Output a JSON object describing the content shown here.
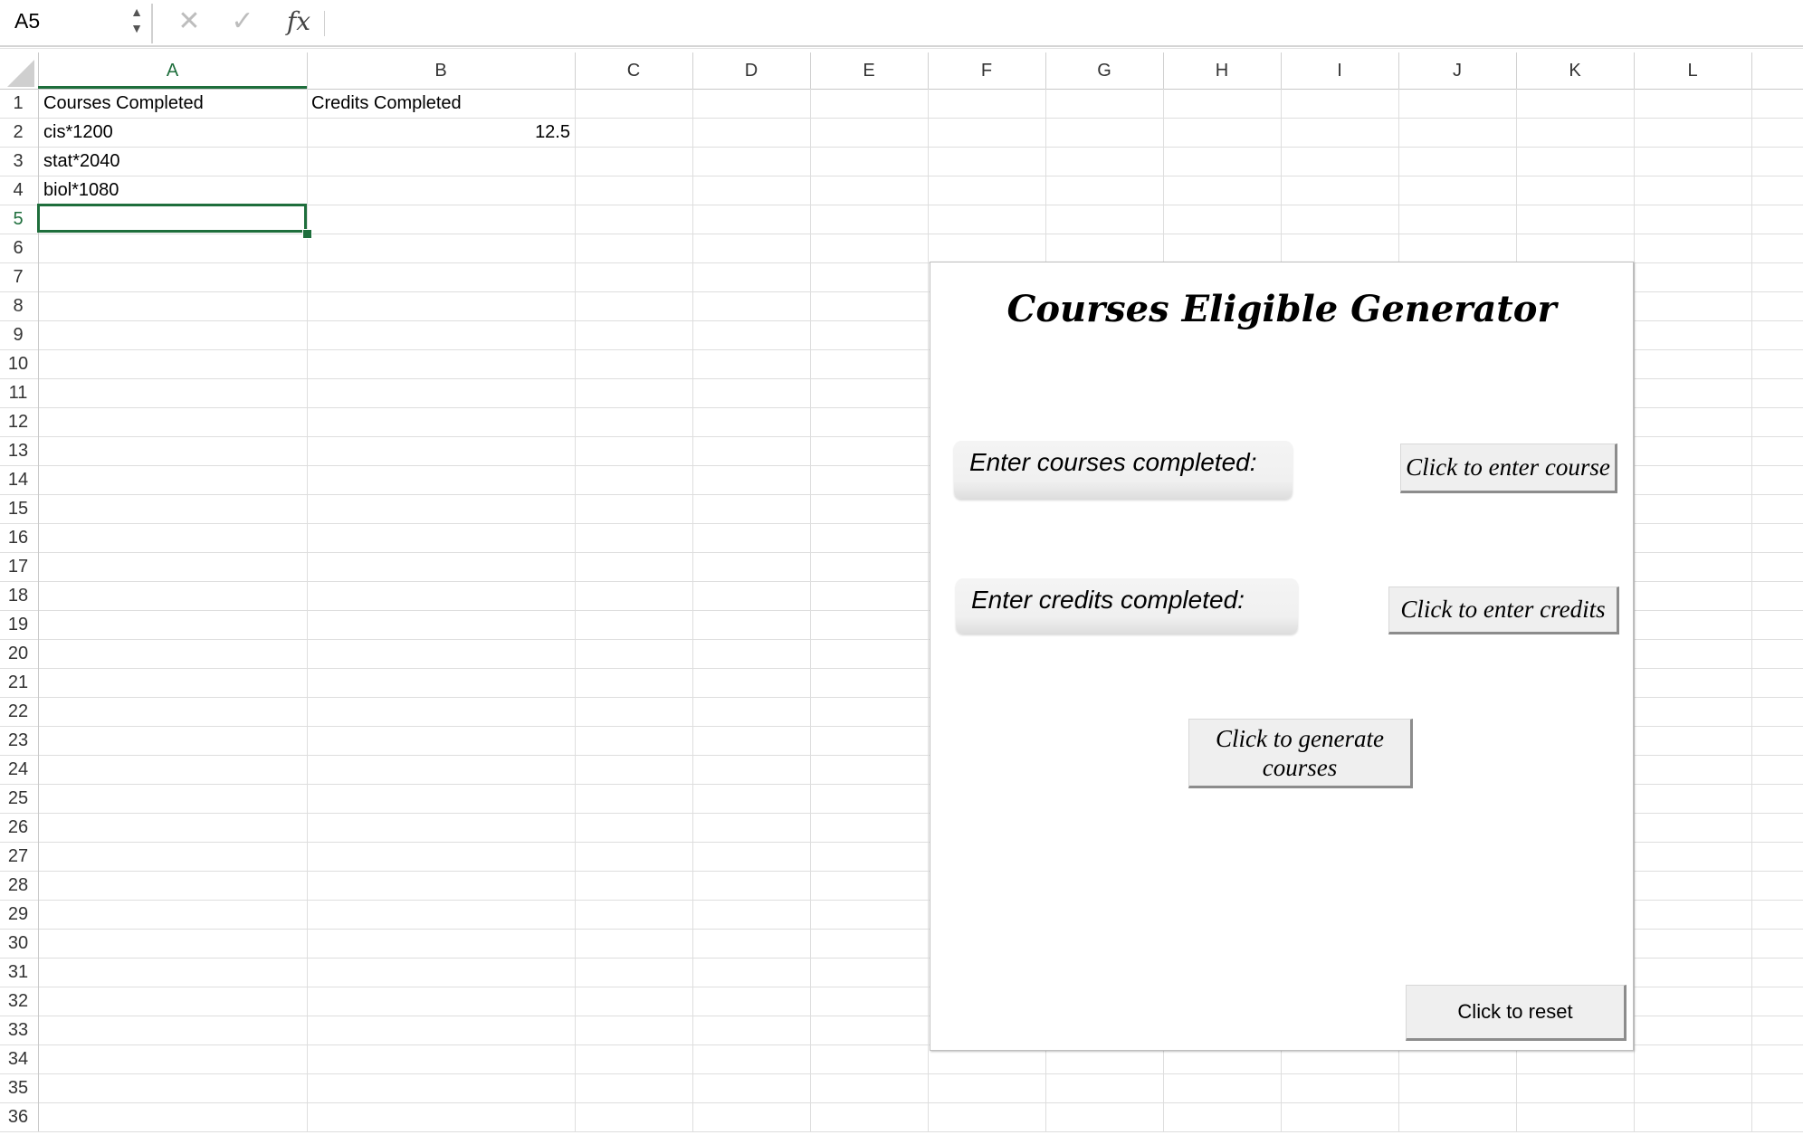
{
  "formula_bar": {
    "name_box": "A5",
    "stepper_icon": "up-down-arrows",
    "cancel_icon": "x-mark",
    "enter_icon": "check-mark",
    "function_icon": "fx",
    "formula": ""
  },
  "sheet": {
    "columns": [
      "A",
      "B",
      "C",
      "D",
      "E",
      "F",
      "G",
      "H",
      "I",
      "J",
      "K",
      "L"
    ],
    "rows": [
      "1",
      "2",
      "3",
      "4",
      "5",
      "6",
      "7",
      "8",
      "9",
      "10",
      "11",
      "12",
      "13",
      "14",
      "15",
      "16",
      "17",
      "18",
      "19",
      "20",
      "21",
      "22",
      "23",
      "24",
      "25",
      "26",
      "27",
      "28",
      "29",
      "30",
      "31",
      "32",
      "33",
      "34",
      "35",
      "36"
    ],
    "selected_cell": "A5",
    "selection_color": "#1e6e3c",
    "cells": {
      "A1": "Courses Completed",
      "B1": "Credits Completed",
      "A2": "cis*1200",
      "B2": "12.5",
      "A3": "stat*2040",
      "A4": "biol*1080"
    }
  },
  "panel": {
    "title": "Courses Eligible Generator",
    "courses_label": "Enter courses completed:",
    "credits_label": "Enter credits completed:",
    "enter_course_button": "Click to enter course",
    "enter_credits_button": "Click to enter credits",
    "generate_button_line1": "Click to generate",
    "generate_button_line2": "courses",
    "reset_button": "Click to reset"
  }
}
